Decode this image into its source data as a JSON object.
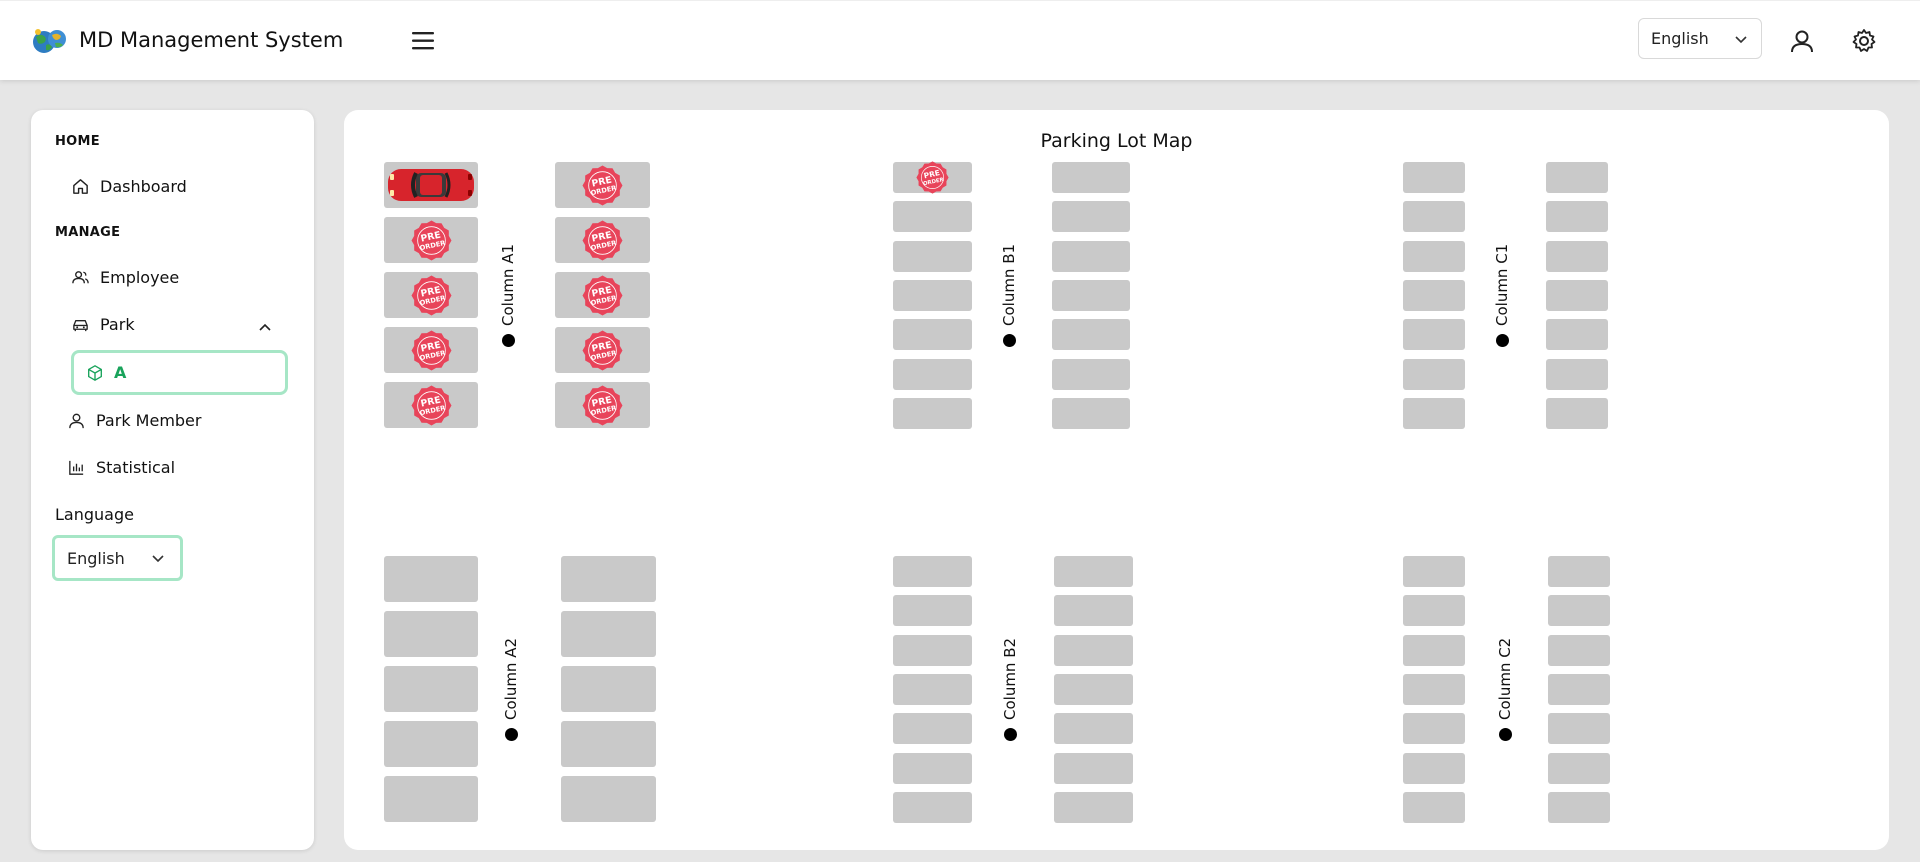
{
  "header": {
    "app_title": "MD Management System",
    "language": "English"
  },
  "sidebar": {
    "home_heading": "HOME",
    "manage_heading": "MANAGE",
    "items": [
      {
        "label": "Dashboard",
        "icon": "home-icon"
      },
      {
        "label": "Employee",
        "icon": "users-icon"
      },
      {
        "label": "Park",
        "icon": "car-icon",
        "expanded": true
      },
      {
        "label": "A",
        "icon": "cube-icon",
        "active": true
      },
      {
        "label": "Park Member",
        "icon": "user-icon"
      },
      {
        "label": "Statistical",
        "icon": "bar-chart-icon"
      }
    ],
    "language_label": "Language",
    "language_value": "English"
  },
  "map": {
    "title": "Parking Lot Map",
    "badge_text": "PRE ORDER",
    "slot_status_legend": [
      "occupied",
      "pre-order",
      "empty"
    ],
    "zones": [
      {
        "id": "A1",
        "label": "Column A1",
        "left": [
          "occupied",
          "pre-order",
          "pre-order",
          "pre-order",
          "pre-order"
        ],
        "right": [
          "pre-order",
          "pre-order",
          "pre-order",
          "pre-order",
          "pre-order"
        ]
      },
      {
        "id": "B1",
        "label": "Column B1",
        "left": [
          "pre-order",
          "empty",
          "empty",
          "empty",
          "empty",
          "empty",
          "empty"
        ],
        "right": [
          "empty",
          "empty",
          "empty",
          "empty",
          "empty",
          "empty",
          "empty"
        ]
      },
      {
        "id": "C1",
        "label": "Column C1",
        "left": [
          "empty",
          "empty",
          "empty",
          "empty",
          "empty",
          "empty",
          "empty"
        ],
        "right": [
          "empty",
          "empty",
          "empty",
          "empty",
          "empty",
          "empty",
          "empty"
        ]
      },
      {
        "id": "A2",
        "label": "Column A2",
        "left": [
          "empty",
          "empty",
          "empty",
          "empty",
          "empty"
        ],
        "right": [
          "empty",
          "empty",
          "empty",
          "empty",
          "empty"
        ]
      },
      {
        "id": "B2",
        "label": "Column B2",
        "left": [
          "empty",
          "empty",
          "empty",
          "empty",
          "empty",
          "empty",
          "empty"
        ],
        "right": [
          "empty",
          "empty",
          "empty",
          "empty",
          "empty",
          "empty",
          "empty"
        ]
      },
      {
        "id": "C2",
        "label": "Column C2",
        "left": [
          "empty",
          "empty",
          "empty",
          "empty",
          "empty",
          "empty",
          "empty"
        ],
        "right": [
          "empty",
          "empty",
          "empty",
          "empty",
          "empty",
          "empty",
          "empty"
        ]
      }
    ]
  },
  "colors": {
    "accent": "#19a35b",
    "accent_border": "#a6e6c6",
    "slot": "#c9c9c9",
    "badge": "#e8445a",
    "car": "#d7242c"
  }
}
